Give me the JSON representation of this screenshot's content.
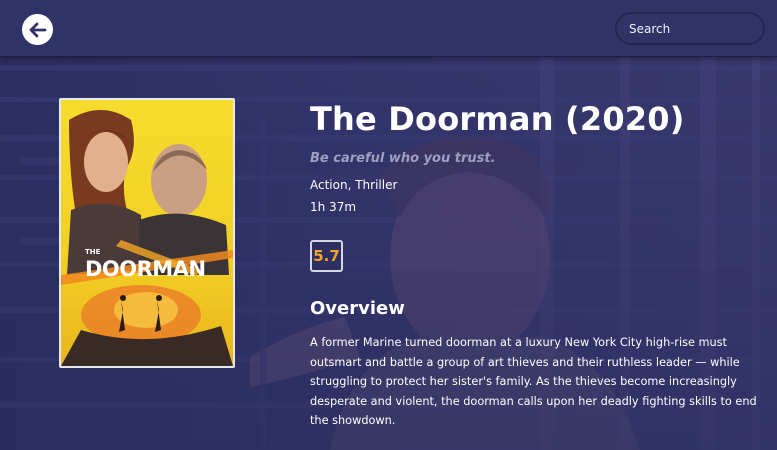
{
  "header": {
    "search_placeholder": "Search",
    "back_icon": "arrow-left-icon"
  },
  "movie": {
    "title": "The Doorman (2020)",
    "tagline": "Be careful who you trust.",
    "genres": "Action, Thriller",
    "runtime": "1h 37m",
    "rating": "5.7",
    "overview_heading": "Overview",
    "overview": "A former Marine turned doorman at a luxury New York City high-rise must outsmart and battle a group of art thieves and their ruthless leader — while struggling to protect her sister's family. As the thieves become increasingly desperate and violent, the doorman calls upon her deadly fighting skills to end the showdown.",
    "poster_title": "THE DOORMAN"
  },
  "colors": {
    "header_bg": "#2f3366",
    "page_bg": "#2a2c5e",
    "rating_text": "#f2a52b",
    "tagline_text": "#9c9fc0",
    "poster_bg": "#f4d62c"
  }
}
